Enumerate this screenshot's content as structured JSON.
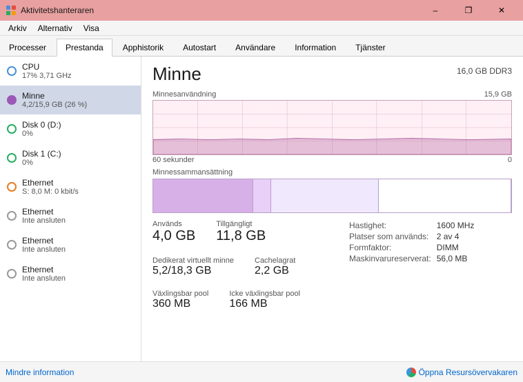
{
  "titleBar": {
    "title": "Aktivitetshanteraren",
    "minimizeLabel": "–",
    "restoreLabel": "❐",
    "closeLabel": "✕"
  },
  "menuBar": {
    "items": [
      "Arkiv",
      "Alternativ",
      "Visa"
    ]
  },
  "tabs": [
    {
      "label": "Processer",
      "active": false
    },
    {
      "label": "Prestanda",
      "active": true
    },
    {
      "label": "Apphistorik",
      "active": false
    },
    {
      "label": "Autostart",
      "active": false
    },
    {
      "label": "Användare",
      "active": false
    },
    {
      "label": "Information",
      "active": false
    },
    {
      "label": "Tjänster",
      "active": false
    }
  ],
  "sidebar": {
    "items": [
      {
        "name": "CPU",
        "sub": "17% 3,71 GHz",
        "iconClass": "blue",
        "active": false
      },
      {
        "name": "Minne",
        "sub": "4,2/15,9 GB (26 %)",
        "iconClass": "purple",
        "active": true
      },
      {
        "name": "Disk 0 (D:)",
        "sub": "0%",
        "iconClass": "green",
        "active": false
      },
      {
        "name": "Disk 1 (C:)",
        "sub": "0%",
        "iconClass": "green",
        "active": false
      },
      {
        "name": "Ethernet",
        "sub": "S: 8,0 M: 0 kbit/s",
        "iconClass": "orange",
        "active": false
      },
      {
        "name": "Ethernet",
        "sub": "Inte ansluten",
        "iconClass": "gray",
        "active": false
      },
      {
        "name": "Ethernet",
        "sub": "Inte ansluten",
        "iconClass": "gray",
        "active": false
      },
      {
        "name": "Ethernet",
        "sub": "Inte ansluten",
        "iconClass": "gray",
        "active": false
      }
    ]
  },
  "panel": {
    "title": "Minne",
    "memSpec": "16,0 GB DDR3",
    "memUsageLabel": "Minnesanvändning",
    "memUsageMax": "15,9 GB",
    "timeLabel": "60 sekunder",
    "timeRight": "0",
    "compositionLabel": "Minnessammansättning",
    "stats": {
      "used": {
        "label": "Används",
        "value": "4,0 GB"
      },
      "available": {
        "label": "Tillgängligt",
        "value": "11,8 GB"
      },
      "dedicated": {
        "label": "Dedikerat virtuellt minne",
        "value": "5,2/18,3 GB"
      },
      "cached": {
        "label": "Cachelagrat",
        "value": "2,2 GB"
      },
      "swappable": {
        "label": "Växlingsbar pool",
        "value": "360 MB"
      },
      "nonSwappable": {
        "label": "Icke växlingsbar pool",
        "value": "166 MB"
      }
    },
    "rightStats": {
      "speed": {
        "label": "Hastighet:",
        "value": "1600 MHz"
      },
      "slots": {
        "label": "Platser som används:",
        "value": "2 av 4"
      },
      "formFactor": {
        "label": "Formfaktor:",
        "value": "DIMM"
      },
      "reserved": {
        "label": "Maskinvarureserverat:",
        "value": "56,0 MB"
      }
    }
  },
  "bottomBar": {
    "lessInfo": "Mindre information",
    "resmon": "Öppna Resursövervakaren"
  }
}
